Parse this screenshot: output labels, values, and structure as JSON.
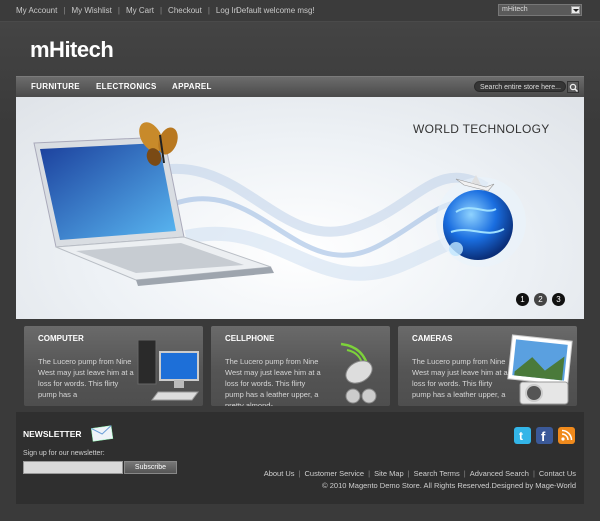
{
  "top_links": [
    "My Account",
    "My Wishlist",
    "My Cart",
    "Checkout",
    "Log In"
  ],
  "welcome": "Default welcome msg!",
  "store_select": "mHitech",
  "logo": "mHitech",
  "nav": [
    "FURNITURE",
    "ELECTRONICS",
    "APPAREL"
  ],
  "search": {
    "placeholder": "Search entire store here..."
  },
  "banner": {
    "title": "WORLD TECHNOLOGY",
    "dots": [
      "1",
      "2",
      "3"
    ]
  },
  "categories": [
    {
      "title": "COMPUTER",
      "desc": "The Lucero pump from Nine West may just leave him at a loss for words. This flirty pump has a"
    },
    {
      "title": "CELLPHONE",
      "desc": "The Lucero pump from Nine West may just leave him at a loss for words. This flirty pump has a leather upper, a pretty almond-"
    },
    {
      "title": "CAMERAS",
      "desc": "The Lucero pump from Nine West may just leave him at a loss for words. This flirty pump has a leather upper, a"
    }
  ],
  "newsletter": {
    "title": "NEWSLETTER",
    "label": "Sign up for our newsletter:",
    "button": "Subscribe"
  },
  "footer_links": [
    "About Us",
    "Customer Service",
    "Site Map",
    "Search Terms",
    "Advanced Search",
    "Contact Us"
  ],
  "copyright": "© 2010 Magento Demo Store. All Rights Reserved.Designed by Mage-World",
  "social": [
    "twitter-icon",
    "facebook-icon",
    "rss-icon"
  ]
}
